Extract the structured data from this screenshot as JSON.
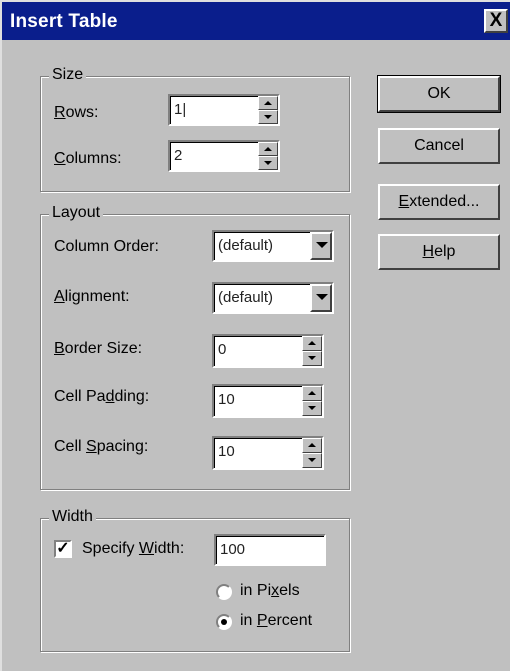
{
  "dialog": {
    "title": "Insert Table",
    "close_glyph": "X"
  },
  "size": {
    "legend": "Size",
    "rows": {
      "label_pre": "",
      "label_u": "R",
      "label_post": "ows:",
      "value": "1|"
    },
    "columns": {
      "label_pre": "",
      "label_u": "C",
      "label_post": "olumns:",
      "value": "2"
    }
  },
  "layout": {
    "legend": "Layout",
    "column_order": {
      "label": "Column Order:",
      "value": "(default)"
    },
    "alignment": {
      "label_pre": "",
      "label_u": "A",
      "label_post": "lignment:",
      "value": "(default)"
    },
    "border_size": {
      "label_pre": "",
      "label_u": "B",
      "label_post": "order Size:",
      "value": "0"
    },
    "cell_padding": {
      "label_pre": "Cell Pa",
      "label_u": "d",
      "label_post": "ding:",
      "value": "10"
    },
    "cell_spacing": {
      "label_pre": "Cell ",
      "label_u": "S",
      "label_post": "pacing:",
      "value": "10"
    }
  },
  "width": {
    "legend": "Width",
    "specify": {
      "label_pre": "Specify ",
      "label_u": "W",
      "label_post": "idth:",
      "checked": true,
      "check_glyph": "✓",
      "value": "100"
    },
    "pixels": {
      "label_pre": "in Pi",
      "label_u": "x",
      "label_post": "els",
      "selected": false
    },
    "percent": {
      "label_pre": "in ",
      "label_u": "P",
      "label_post": "ercent",
      "selected": true
    }
  },
  "buttons": {
    "ok": "OK",
    "cancel": "Cancel",
    "extended_u": "E",
    "extended_post": "xtended...",
    "help_u": "H",
    "help_post": "elp"
  }
}
